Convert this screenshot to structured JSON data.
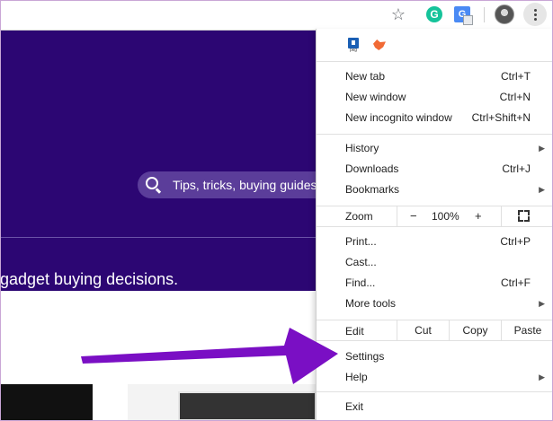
{
  "toolbar": {
    "icons": [
      "star-icon",
      "grammarly-icon",
      "google-translate-icon",
      "profile-avatar",
      "more-vert-icon"
    ],
    "grammarly_letter": "G",
    "translate_letter": "G"
  },
  "page": {
    "search_placeholder": "Tips, tricks, buying guides",
    "tagline": "gadget buying decisions.",
    "hero_color": "#2c0673"
  },
  "menu": {
    "extensions": [
      "package-extension-icon",
      "fox-extension-icon"
    ],
    "ext_pkg_label": "pkg",
    "new_tab": {
      "label": "New tab",
      "shortcut": "Ctrl+T"
    },
    "new_window": {
      "label": "New window",
      "shortcut": "Ctrl+N"
    },
    "new_incognito": {
      "label": "New incognito window",
      "shortcut": "Ctrl+Shift+N"
    },
    "history": {
      "label": "History"
    },
    "downloads": {
      "label": "Downloads",
      "shortcut": "Ctrl+J"
    },
    "bookmarks": {
      "label": "Bookmarks"
    },
    "zoom": {
      "label": "Zoom",
      "minus": "−",
      "value": "100%",
      "plus": "+"
    },
    "print": {
      "label": "Print...",
      "shortcut": "Ctrl+P"
    },
    "cast": {
      "label": "Cast..."
    },
    "find": {
      "label": "Find...",
      "shortcut": "Ctrl+F"
    },
    "more_tools": {
      "label": "More tools"
    },
    "edit": {
      "label": "Edit",
      "cut": "Cut",
      "copy": "Copy",
      "paste": "Paste"
    },
    "settings": {
      "label": "Settings"
    },
    "help": {
      "label": "Help"
    },
    "exit": {
      "label": "Exit"
    }
  },
  "annotation": {
    "arrow_color": "#7a0fc4"
  }
}
